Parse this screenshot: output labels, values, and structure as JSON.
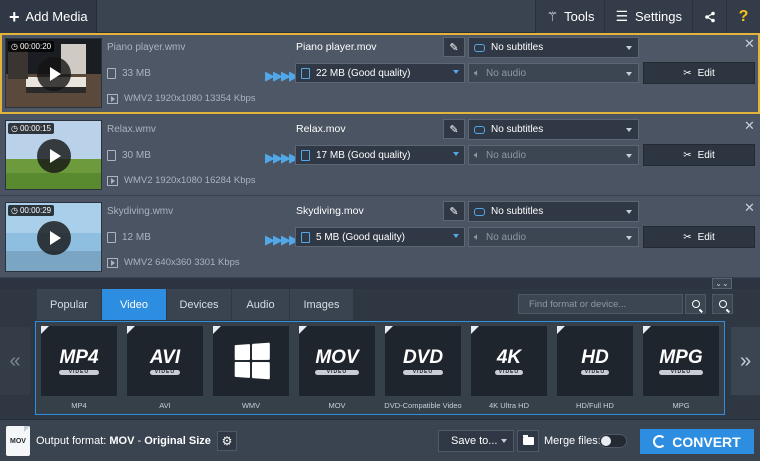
{
  "toolbar": {
    "add_media_label": "Add Media",
    "tools_label": "Tools",
    "settings_label": "Settings"
  },
  "files": [
    {
      "duration": "00:00:20",
      "src_name": "Piano player.wmv",
      "src_size": "33 MB",
      "src_meta": "WMV2 1920x1080 13354 Kbps",
      "out_name": "Piano player.mov",
      "out_size": "22 MB (Good quality)",
      "subtitles": "No subtitles",
      "audio": "No audio",
      "edit_label": "Edit"
    },
    {
      "duration": "00:00:15",
      "src_name": "Relax.wmv",
      "src_size": "30 MB",
      "src_meta": "WMV2 1920x1080 16284 Kbps",
      "out_name": "Relax.mov",
      "out_size": "17 MB (Good quality)",
      "subtitles": "No subtitles",
      "audio": "No audio",
      "edit_label": "Edit"
    },
    {
      "duration": "00:00:29",
      "src_name": "Skydiving.wmv",
      "src_size": "12 MB",
      "src_meta": "WMV2 640x360 3301 Kbps",
      "out_name": "Skydiving.mov",
      "out_size": "5 MB (Good quality)",
      "subtitles": "No subtitles",
      "audio": "No audio",
      "edit_label": "Edit"
    }
  ],
  "format_tabs": [
    "Popular",
    "Video",
    "Devices",
    "Audio",
    "Images"
  ],
  "active_tab": "Video",
  "search": {
    "placeholder": "Find format or device..."
  },
  "format_tiles": [
    {
      "logo": "MP4",
      "sub": "VIDEO",
      "label": "MP4"
    },
    {
      "logo": "AVI",
      "sub": "VIDEO",
      "label": "AVI"
    },
    {
      "logo": "",
      "sub": "",
      "label": "WMV"
    },
    {
      "logo": "MOV",
      "sub": "VIDEO",
      "label": "MOV"
    },
    {
      "logo": "DVD",
      "sub": "VIDEO",
      "label": "DVD-Compatible Video"
    },
    {
      "logo": "4K",
      "sub": "VIDEO",
      "label": "4K Ultra HD"
    },
    {
      "logo": "HD",
      "sub": "VIDEO",
      "label": "HD/Full HD"
    },
    {
      "logo": "MPG",
      "sub": "VIDEO",
      "label": "MPG"
    }
  ],
  "bottom": {
    "file_icon_text": "MOV",
    "output_prefix": "Output format:",
    "output_format": "MOV",
    "output_sep": "-",
    "output_variant": "Original Size",
    "save_label": "Save to...",
    "merge_label": "Merge files:",
    "convert_label": "CONVERT"
  },
  "colors": {
    "accent": "#2d8de0",
    "selected_outline": "#e2b43a",
    "help_icon": "#f5c518"
  }
}
